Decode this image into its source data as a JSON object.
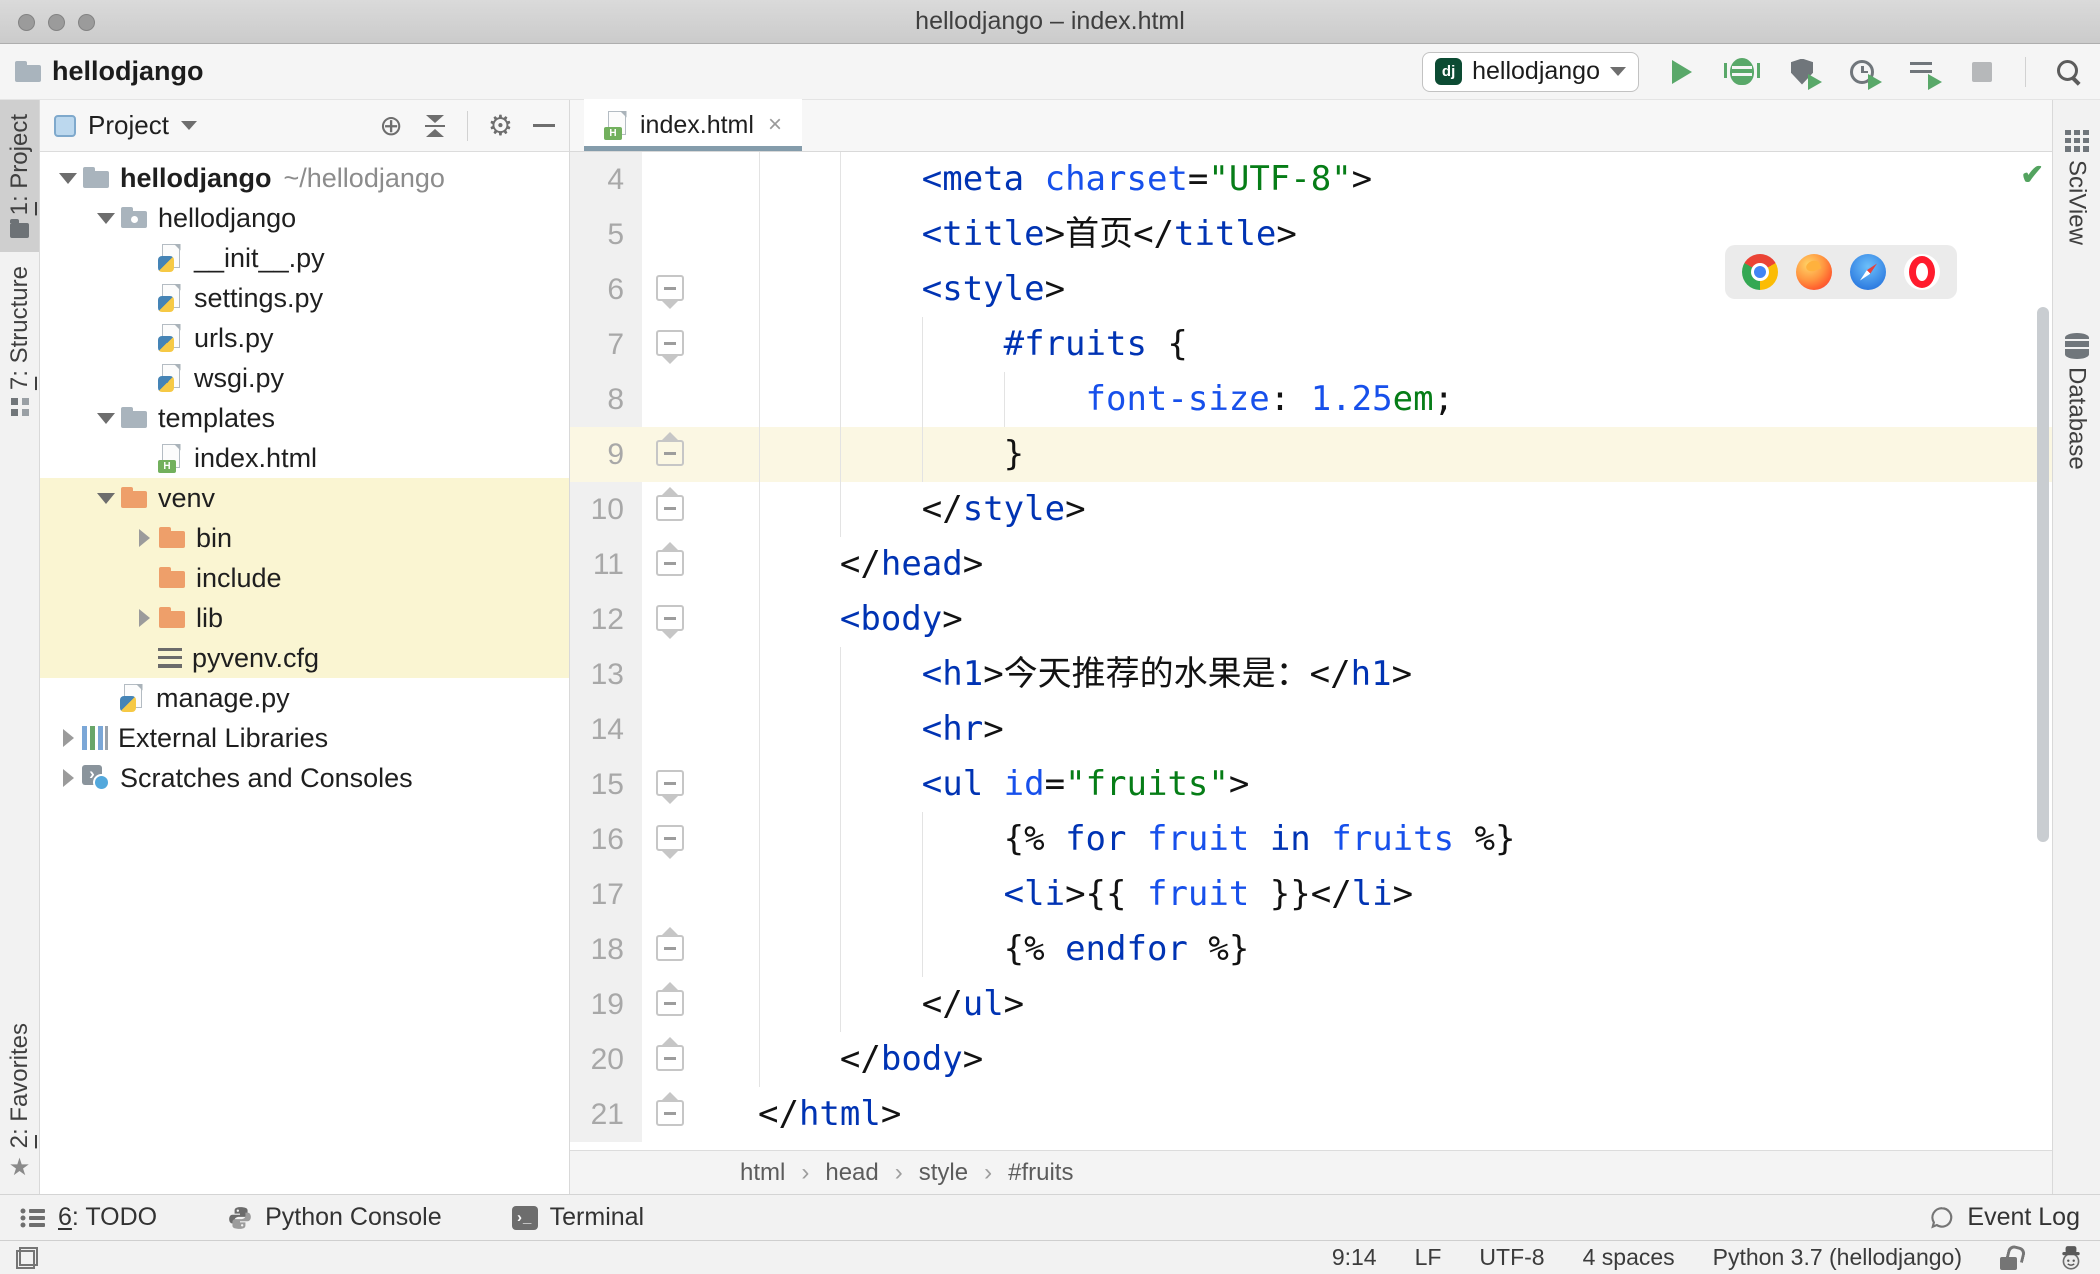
{
  "window": {
    "title": "hellodjango – index.html"
  },
  "toolbar": {
    "project_label": "hellodjango",
    "run_config": {
      "badge": "dj",
      "name": "hellodjango"
    }
  },
  "stripes": {
    "left": [
      {
        "num": "1",
        "label": ": Project"
      },
      {
        "num": "7",
        "label": ": Structure"
      },
      {
        "num": "2",
        "label": ": Favorites"
      }
    ],
    "right": [
      "SciView",
      "Database"
    ]
  },
  "project_panel": {
    "title": "Project",
    "tree": [
      {
        "label": "hellodjango",
        "suffix": "~/hellodjango",
        "icon": "folder",
        "level": 0,
        "arrow": "down",
        "bold": true
      },
      {
        "label": "hellodjango",
        "icon": "package",
        "level": 1,
        "arrow": "down"
      },
      {
        "label": "__init__.py",
        "icon": "python",
        "level": 2
      },
      {
        "label": "settings.py",
        "icon": "python",
        "level": 2
      },
      {
        "label": "urls.py",
        "icon": "python",
        "level": 2
      },
      {
        "label": "wsgi.py",
        "icon": "python",
        "level": 2
      },
      {
        "label": "templates",
        "icon": "folder",
        "level": 1,
        "arrow": "down"
      },
      {
        "label": "index.html",
        "icon": "html",
        "level": 2
      },
      {
        "label": "venv",
        "icon": "folder-excluded",
        "level": 1,
        "arrow": "down",
        "highlight": true
      },
      {
        "label": "bin",
        "icon": "folder-excluded",
        "level": 2,
        "arrow": "right",
        "highlight": true
      },
      {
        "label": "include",
        "icon": "folder-excluded",
        "level": 2,
        "highlight": true
      },
      {
        "label": "lib",
        "icon": "folder-excluded",
        "level": 2,
        "arrow": "right",
        "highlight": true
      },
      {
        "label": "pyvenv.cfg",
        "icon": "text",
        "level": 2,
        "highlight": true
      },
      {
        "label": "manage.py",
        "icon": "python",
        "level": 1
      },
      {
        "label": "External Libraries",
        "icon": "libraries",
        "level": 0,
        "arrow": "right"
      },
      {
        "label": "Scratches and Consoles",
        "icon": "scratches",
        "level": 0,
        "arrow": "right"
      }
    ]
  },
  "editor": {
    "tab": "index.html",
    "breadcrumbs": [
      "html",
      "head",
      "style",
      "#fruits"
    ],
    "lines": [
      {
        "n": 4,
        "ind": 8,
        "tokens": [
          [
            "tag",
            "<meta "
          ],
          [
            "attr",
            "charset"
          ],
          [
            "txt",
            "="
          ],
          [
            "str",
            "\"UTF-8\""
          ],
          [
            "txt",
            ">"
          ]
        ]
      },
      {
        "n": 5,
        "ind": 8,
        "tokens": [
          [
            "tag",
            "<title"
          ],
          [
            "txt",
            ">"
          ],
          [
            "txt",
            "首页"
          ],
          [
            "txt",
            "</"
          ],
          [
            "tag",
            "title"
          ],
          [
            "txt",
            ">"
          ]
        ]
      },
      {
        "n": 6,
        "ind": 8,
        "fold": "down",
        "tokens": [
          [
            "tag",
            "<style"
          ],
          [
            "txt",
            ">"
          ]
        ]
      },
      {
        "n": 7,
        "ind": 12,
        "fold": "down",
        "tokens": [
          [
            "tag",
            "#fruits"
          ],
          [
            "txt",
            " {"
          ]
        ]
      },
      {
        "n": 8,
        "ind": 16,
        "tokens": [
          [
            "attr",
            "font-size"
          ],
          [
            "txt",
            ": "
          ],
          [
            "attr",
            "1.25"
          ],
          [
            "str",
            "em"
          ],
          [
            "txt",
            ";"
          ]
        ]
      },
      {
        "n": 9,
        "ind": 12,
        "fold": "up",
        "cur": true,
        "tokens": [
          [
            "txt",
            "}"
          ]
        ]
      },
      {
        "n": 10,
        "ind": 8,
        "fold": "up",
        "tokens": [
          [
            "txt",
            "</"
          ],
          [
            "tag",
            "style"
          ],
          [
            "txt",
            ">"
          ]
        ]
      },
      {
        "n": 11,
        "ind": 4,
        "fold": "up",
        "tokens": [
          [
            "txt",
            "</"
          ],
          [
            "tag",
            "head"
          ],
          [
            "txt",
            ">"
          ]
        ]
      },
      {
        "n": 12,
        "ind": 4,
        "fold": "down",
        "tokens": [
          [
            "tag",
            "<body"
          ],
          [
            "txt",
            ">"
          ]
        ]
      },
      {
        "n": 13,
        "ind": 8,
        "tokens": [
          [
            "tag",
            "<h1"
          ],
          [
            "txt",
            ">"
          ],
          [
            "txt",
            "今天推荐的水果是："
          ],
          [
            "txt",
            "</"
          ],
          [
            "tag",
            "h1"
          ],
          [
            "txt",
            ">"
          ]
        ]
      },
      {
        "n": 14,
        "ind": 8,
        "tokens": [
          [
            "tag",
            "<hr"
          ],
          [
            "txt",
            ">"
          ]
        ]
      },
      {
        "n": 15,
        "ind": 8,
        "fold": "down",
        "tokens": [
          [
            "tag",
            "<ul "
          ],
          [
            "attr",
            "id"
          ],
          [
            "txt",
            "="
          ],
          [
            "str",
            "\"fruits\""
          ],
          [
            "txt",
            ">"
          ]
        ]
      },
      {
        "n": 16,
        "ind": 12,
        "fold": "down",
        "tokens": [
          [
            "txt",
            "{% "
          ],
          [
            "kw",
            "for"
          ],
          [
            "txt",
            " "
          ],
          [
            "attr",
            "fruit"
          ],
          [
            "txt",
            " "
          ],
          [
            "kw",
            "in"
          ],
          [
            "txt",
            " "
          ],
          [
            "attr",
            "fruits"
          ],
          [
            "txt",
            " %}"
          ]
        ]
      },
      {
        "n": 17,
        "ind": 12,
        "tokens": [
          [
            "tag",
            "<li"
          ],
          [
            "txt",
            ">"
          ],
          [
            "txt",
            "{{ "
          ],
          [
            "attr",
            "fruit"
          ],
          [
            "txt",
            " }}"
          ],
          [
            "txt",
            "</"
          ],
          [
            "tag",
            "li"
          ],
          [
            "txt",
            ">"
          ]
        ]
      },
      {
        "n": 18,
        "ind": 12,
        "fold": "up",
        "tokens": [
          [
            "txt",
            "{% "
          ],
          [
            "kw",
            "endfor"
          ],
          [
            "txt",
            " %}"
          ]
        ]
      },
      {
        "n": 19,
        "ind": 8,
        "fold": "up",
        "tokens": [
          [
            "txt",
            "</"
          ],
          [
            "tag",
            "ul"
          ],
          [
            "txt",
            ">"
          ]
        ]
      },
      {
        "n": 20,
        "ind": 4,
        "fold": "up",
        "tokens": [
          [
            "txt",
            "</"
          ],
          [
            "tag",
            "body"
          ],
          [
            "txt",
            ">"
          ]
        ]
      },
      {
        "n": 21,
        "ind": 0,
        "fold": "up",
        "tokens": [
          [
            "txt",
            "</"
          ],
          [
            "tag",
            "html"
          ],
          [
            "txt",
            ">"
          ]
        ]
      }
    ],
    "browser_icons": [
      "chrome",
      "firefox",
      "safari",
      "opera"
    ],
    "inspection_ok_icon": "check"
  },
  "bottom_bar": {
    "todo": {
      "num": "6",
      "label": ": TODO"
    },
    "python_console": "Python Console",
    "terminal": "Terminal",
    "event_log": "Event Log"
  },
  "status_bar": {
    "caret": "9:14",
    "line_separator": "LF",
    "encoding": "UTF-8",
    "indent": "4 spaces",
    "interpreter": "Python 3.7 (hellodjango)"
  },
  "colors": {
    "c-tag": "#0033b3",
    "c-attr": "#1750eb",
    "c-str": "#067d17",
    "c-kw": "#0033b3",
    "accent-tab-underline": "#849cab",
    "current-line": "#fbf7e3",
    "excluded-row": "#faf5d2",
    "run-green": "#59a869",
    "django-badge": "#0c4b33"
  }
}
